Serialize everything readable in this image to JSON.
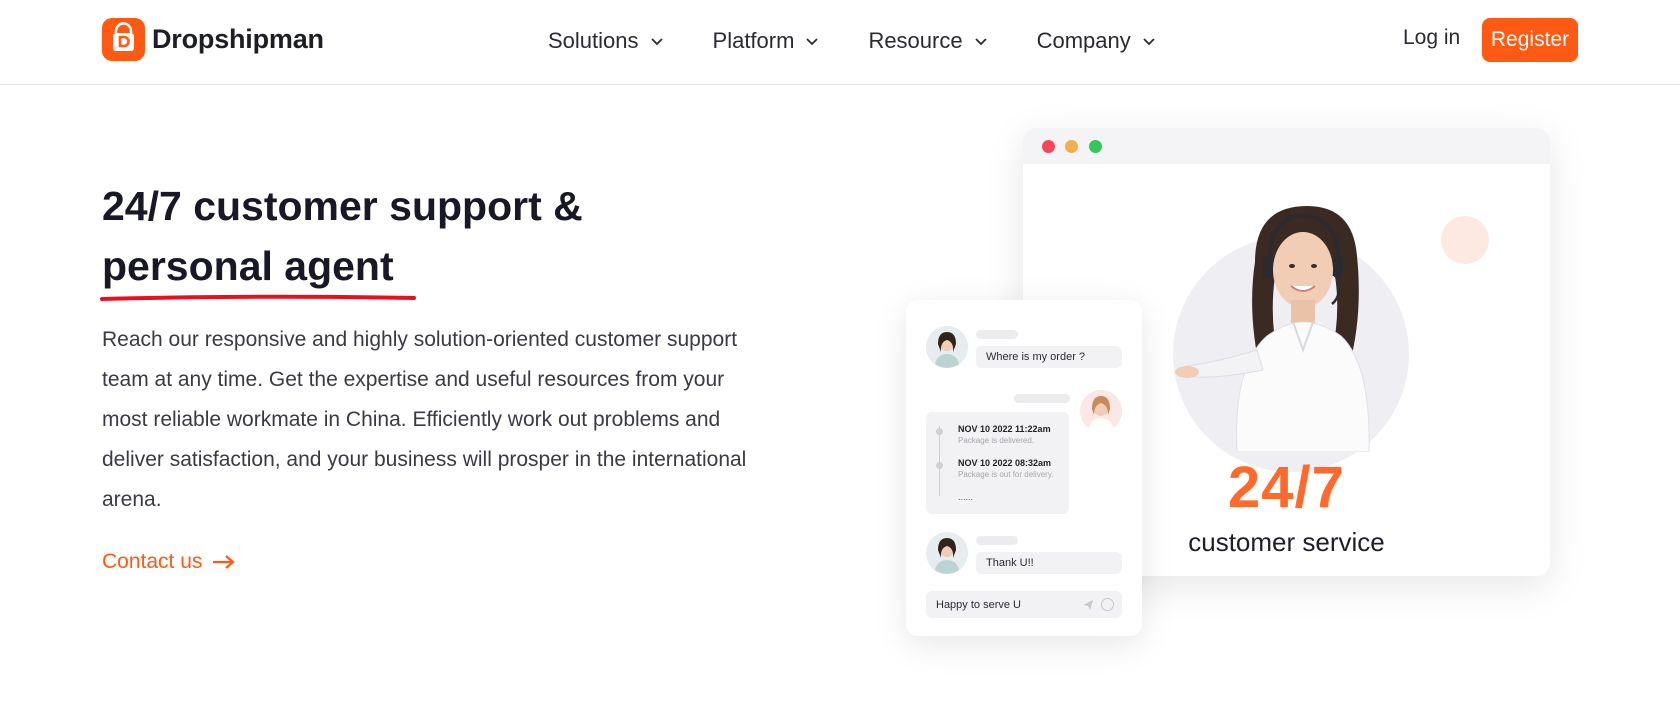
{
  "brand": {
    "name": "Dropshipman",
    "accent": "#ff5a14"
  },
  "nav": {
    "items": [
      {
        "label": "Solutions"
      },
      {
        "label": "Platform"
      },
      {
        "label": "Resource"
      },
      {
        "label": "Company"
      }
    ],
    "login_label": "Log in",
    "register_label": "Register"
  },
  "hero": {
    "headline_line1": "24/7 customer support &",
    "headline_line2": "personal agent",
    "body": "Reach our responsive and highly solution-oriented customer support team at any time. Get the expertise and useful resources from your most reliable workmate in China. Efficiently work out problems and deliver satisfaction, and your business will prosper in the international arena.",
    "cta_label": "Contact us"
  },
  "illustration": {
    "big_label": "24/7",
    "sub_label": "customer service",
    "chat": {
      "msg1": "Where is my order ?",
      "tl1_date": "NOV 10 2022 11:22am",
      "tl1_sub": "Package is delivered.",
      "tl2_date": "NOV 10 2022 08:32am",
      "tl2_sub": "Package is out for delivery.",
      "tl_more": "......",
      "msg2": "Thank U!!",
      "input_text": "Happy to serve U"
    }
  }
}
